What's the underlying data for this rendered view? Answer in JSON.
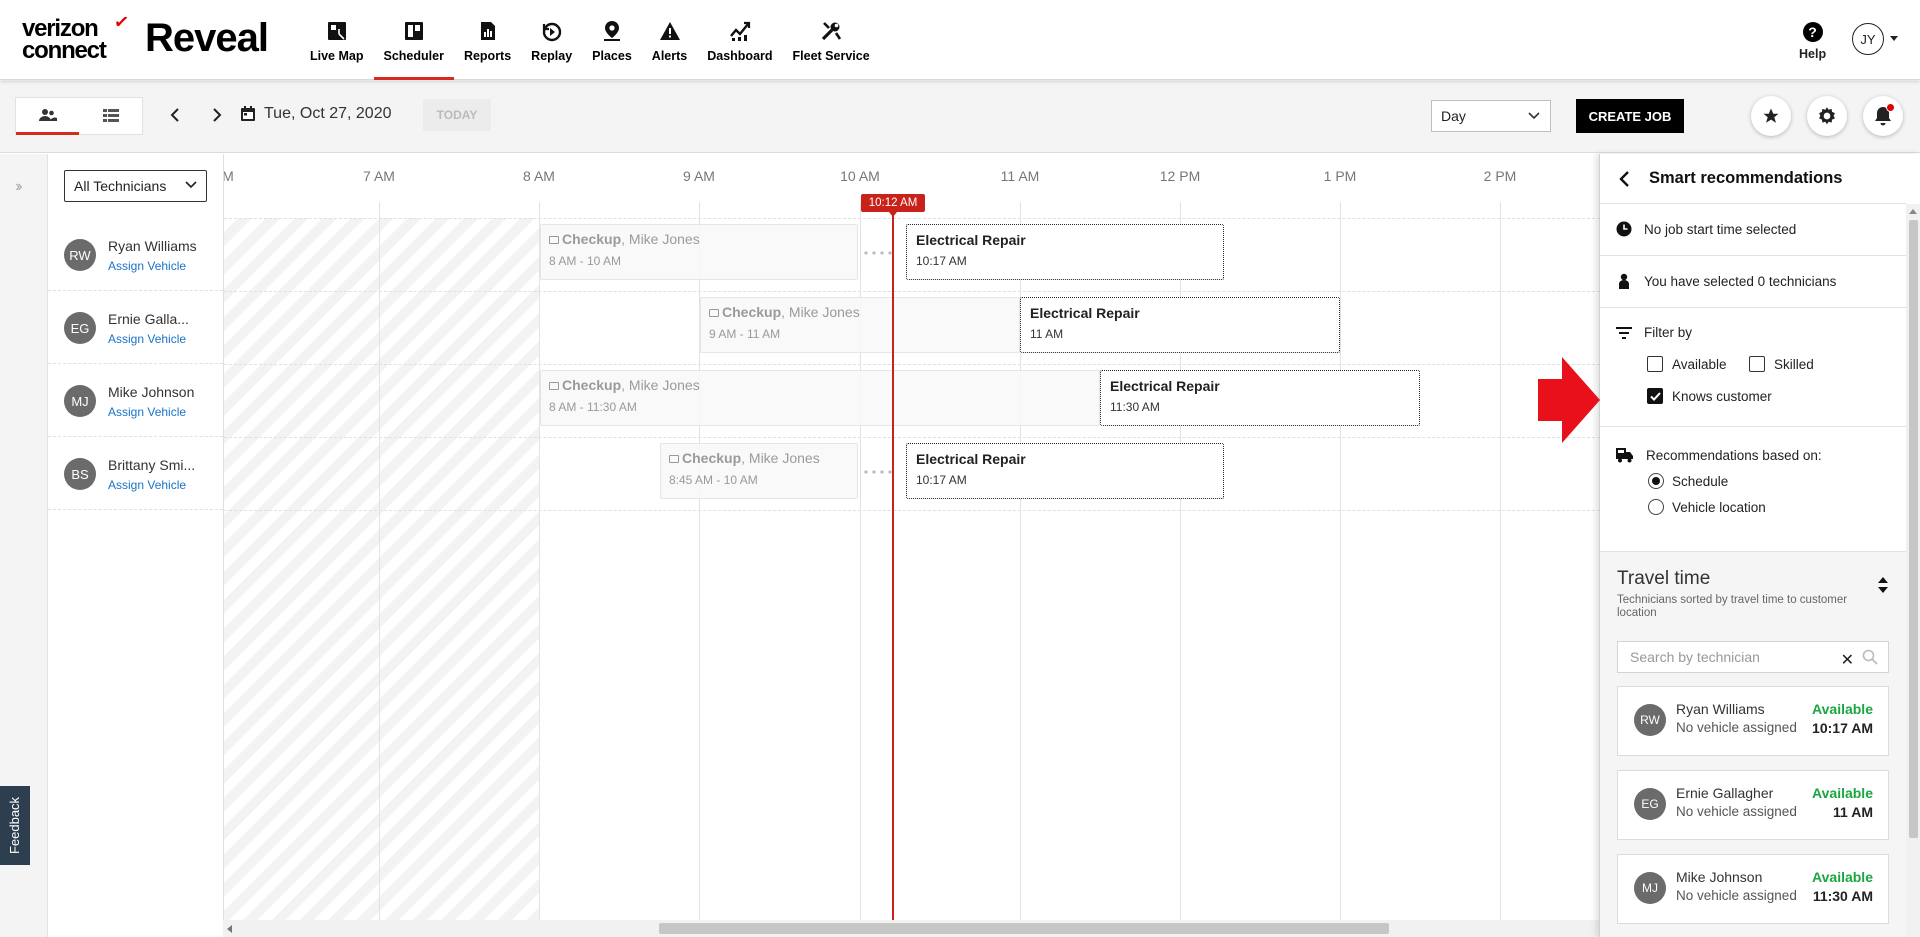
{
  "brand": {
    "line1": "verizon",
    "line2": "connect",
    "check": "✓",
    "product": "Reveal"
  },
  "nav": {
    "items": [
      {
        "label": "Live Map",
        "icon": "map-icon"
      },
      {
        "label": "Scheduler",
        "icon": "scheduler-icon"
      },
      {
        "label": "Reports",
        "icon": "reports-icon"
      },
      {
        "label": "Replay",
        "icon": "replay-icon"
      },
      {
        "label": "Places",
        "icon": "places-icon"
      },
      {
        "label": "Alerts",
        "icon": "alert-icon"
      },
      {
        "label": "Dashboard",
        "icon": "dashboard-icon"
      },
      {
        "label": "Fleet Service",
        "icon": "tools-icon"
      }
    ],
    "active": "Scheduler",
    "help_label": "Help",
    "user_initials": "JY"
  },
  "toolbar": {
    "date": "Tue, Oct 27, 2020",
    "today_label": "TODAY",
    "view_select": "Day",
    "create_job_label": "CREATE JOB"
  },
  "scheduler": {
    "tech_filter": "All Technicians",
    "hours": [
      "M",
      "7 AM",
      "8 AM",
      "9 AM",
      "10 AM",
      "11 AM",
      "12 PM",
      "1 PM",
      "2 PM"
    ],
    "now_label": "10:12 AM",
    "technicians": [
      {
        "initials": "RW",
        "name": "Ryan Williams",
        "assign": "Assign Vehicle",
        "job": {
          "title": "Checkup",
          "person": ", Mike Jones",
          "time": "8 AM - 10 AM"
        },
        "new_job": {
          "title": "Electrical Repair",
          "time": "10:17 AM"
        }
      },
      {
        "initials": "EG",
        "name": "Ernie Galla...",
        "assign": "Assign Vehicle",
        "job": {
          "title": "Checkup",
          "person": ", Mike Jones",
          "time": "9 AM - 11 AM"
        },
        "new_job": {
          "title": "Electrical Repair",
          "time": "11 AM"
        }
      },
      {
        "initials": "MJ",
        "name": "Mike Johnson",
        "assign": "Assign Vehicle",
        "job": {
          "title": "Checkup",
          "person": ", Mike Jones",
          "time": "8 AM - 11:30 AM"
        },
        "new_job": {
          "title": "Electrical Repair",
          "time": "11:30 AM"
        }
      },
      {
        "initials": "BS",
        "name": "Brittany Smi...",
        "assign": "Assign Vehicle",
        "job": {
          "title": "Checkup",
          "person": ", Mike Jones",
          "time": "8:45 AM - 10 AM"
        },
        "new_job": {
          "title": "Electrical Repair",
          "time": "10:17 AM"
        }
      }
    ]
  },
  "feedback_label": "Feedback",
  "panel": {
    "title": "Smart recommendations",
    "start_time_text": "No job start time selected",
    "selected_text": "You have selected 0 technicians",
    "filter_label": "Filter by",
    "filters": [
      {
        "label": "Available",
        "checked": false
      },
      {
        "label": "Skilled",
        "checked": false
      },
      {
        "label": "Knows customer",
        "checked": true
      }
    ],
    "based_on_label": "Recommendations based on:",
    "based_on_options": [
      {
        "label": "Schedule",
        "selected": true
      },
      {
        "label": "Vehicle location",
        "selected": false
      }
    ],
    "travel_title": "Travel time",
    "travel_subtitle": "Technicians sorted by travel time to customer location",
    "search_placeholder": "Search by technician",
    "recommendations": [
      {
        "initials": "RW",
        "name": "Ryan Williams",
        "vehicle": "No vehicle assigned",
        "status": "Available",
        "time": "10:17 AM"
      },
      {
        "initials": "EG",
        "name": "Ernie Gallagher",
        "vehicle": "No vehicle assigned",
        "status": "Available",
        "time": "11 AM"
      },
      {
        "initials": "MJ",
        "name": "Mike Johnson",
        "vehicle": "No vehicle assigned",
        "status": "Available",
        "time": "11:30 AM"
      }
    ]
  },
  "colors": {
    "accent_red": "#d52b1e",
    "now_line": "#c8221a",
    "available_green": "#1aa640",
    "link_blue": "#1a73c8"
  }
}
